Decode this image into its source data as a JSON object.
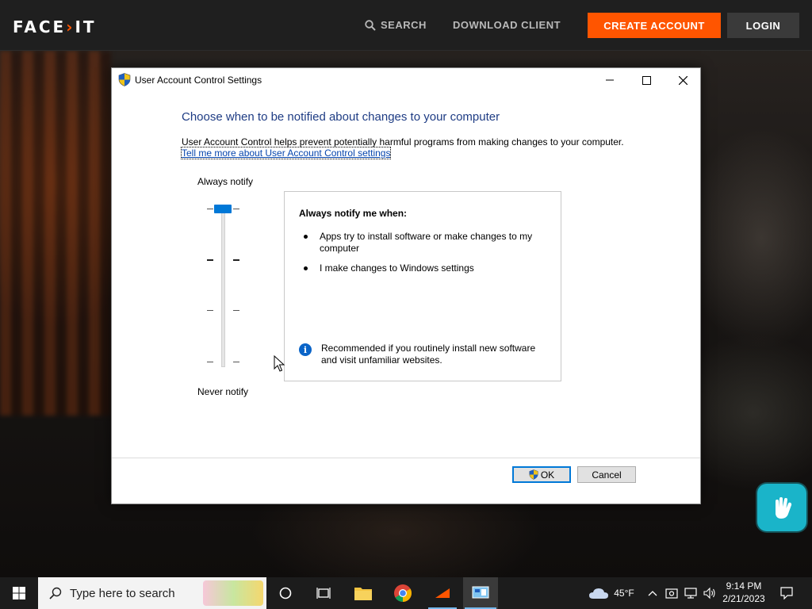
{
  "faceit": {
    "logo": "FACEIT",
    "nav": {
      "search": "SEARCH",
      "download": "DOWNLOAD CLIENT",
      "create_account": "CREATE ACCOUNT",
      "login": "LOGIN"
    },
    "colors": {
      "accent": "#ff5500",
      "topbar": "#1f1f1f"
    }
  },
  "dialog": {
    "title": "User Account Control Settings",
    "heading": "Choose when to be notified about changes to your computer",
    "description": "User Account Control helps prevent potentially harmful programs from making changes to your computer.",
    "link": "Tell me more about User Account Control settings",
    "slider": {
      "top_label": "Always notify",
      "bottom_label": "Never notify",
      "level": 4,
      "levels": 4
    },
    "info": {
      "title": "Always notify me when:",
      "bullets": [
        "Apps try to install software or make changes to my computer",
        "I make changes to Windows settings"
      ],
      "note": "Recommended if you routinely install new software and visit unfamiliar websites."
    },
    "buttons": {
      "ok": "OK",
      "cancel": "Cancel"
    }
  },
  "taskbar": {
    "search_placeholder": "Type here to search",
    "weather": "45°F",
    "time": "9:14 PM",
    "date": "2/21/2023",
    "icons": [
      "windows-start-icon",
      "cortana-icon",
      "task-view-icon",
      "file-explorer-icon",
      "chrome-icon",
      "faceit-app-icon",
      "control-panel-icon"
    ]
  }
}
